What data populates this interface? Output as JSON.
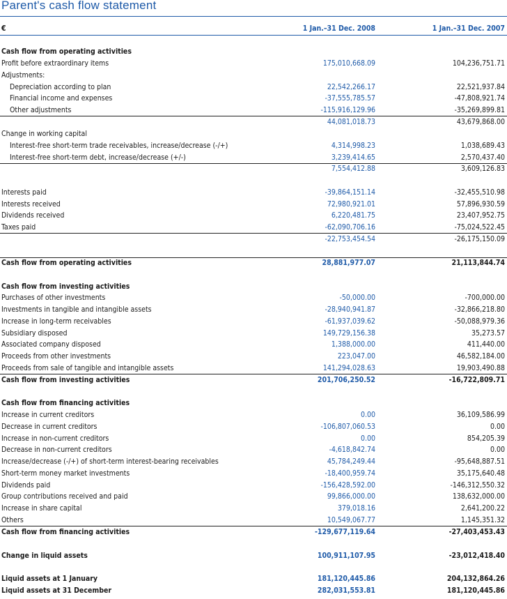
{
  "title": "Parent's cash flow statement",
  "header": {
    "currency": "€",
    "period_2008": "1 Jan.–31 Dec. 2008",
    "period_2007": "1 Jan.–31 Dec. 2007"
  },
  "rows": [
    {
      "label": "Cash flow from operating activities",
      "v1": "",
      "v2": ""
    },
    {
      "label": "Profit before extraordinary items",
      "v1": "175,010,668.09",
      "v2": "104,236,751.71"
    },
    {
      "label": "Adjustments:",
      "v1": "",
      "v2": ""
    },
    {
      "label": "Depreciation according to plan",
      "v1": "22,542,266.17",
      "v2": "22,521,937.84"
    },
    {
      "label": "Financial income and expenses",
      "v1": "-37,555,785.57",
      "v2": "-47,808,921.74"
    },
    {
      "label": "Other adjustments",
      "v1": "-115,916,129.96",
      "v2": "-35,269,899.81"
    },
    {
      "label": "",
      "v1": "44,081,018.73",
      "v2": "43,679,868.00"
    },
    {
      "label": "Change in working capital",
      "v1": "",
      "v2": ""
    },
    {
      "label": "Interest-free short-term trade receivables, increase/decrease (-/+)",
      "v1": "4,314,998.23",
      "v2": "1,038,689.43"
    },
    {
      "label": "Interest-free short-term debt, increase/decrease (+/-)",
      "v1": "3,239,414.65",
      "v2": "2,570,437.40"
    },
    {
      "label": "",
      "v1": "7,554,412.88",
      "v2": "3,609,126.83"
    },
    {
      "label": "Interests paid",
      "v1": "-39,864,151.14",
      "v2": "-32,455,510.98"
    },
    {
      "label": "Interests received",
      "v1": "72,980,921.01",
      "v2": "57,896,930.59"
    },
    {
      "label": "Dividends received",
      "v1": "6,220,481.75",
      "v2": "23,407,952.75"
    },
    {
      "label": "Taxes paid",
      "v1": "-62,090,706.16",
      "v2": "-75,024,522.45"
    },
    {
      "label": "",
      "v1": "-22,753,454.54",
      "v2": "-26,175,150.09"
    },
    {
      "label": "Cash flow from operating activities",
      "v1": "28,881,977.07",
      "v2": "21,113,844.74"
    },
    {
      "label": "Cash flow from investing activities",
      "v1": "",
      "v2": ""
    },
    {
      "label": "Purchases of other investments",
      "v1": "-50,000.00",
      "v2": "-700,000.00"
    },
    {
      "label": "Investments in tangible and intangible assets",
      "v1": "-28,940,941.87",
      "v2": "-32,866,218.80"
    },
    {
      "label": "Increase in long-term receivables",
      "v1": "-61,937,039.62",
      "v2": "-50,088,979.36"
    },
    {
      "label": "Subsidiary disposed",
      "v1": "149,729,156.38",
      "v2": "35,273.57"
    },
    {
      "label": "Associated company disposed",
      "v1": "1,388,000.00",
      "v2": "411,440.00"
    },
    {
      "label": "Proceeds from other investments",
      "v1": "223,047.00",
      "v2": "46,582,184.00"
    },
    {
      "label": "Proceeds from sale of tangible and intangible assets",
      "v1": "141,294,028.63",
      "v2": "19,903,490.88"
    },
    {
      "label": "Cash flow from investing activities",
      "v1": "201,706,250.52",
      "v2": "-16,722,809.71"
    },
    {
      "label": "Cash flow from financing activities",
      "v1": "",
      "v2": ""
    },
    {
      "label": "Increase in current creditors",
      "v1": "0.00",
      "v2": "36,109,586.99"
    },
    {
      "label": "Decrease in current creditors",
      "v1": "-106,807,060.53",
      "v2": "0.00"
    },
    {
      "label": "Increase in non-current creditors",
      "v1": "0.00",
      "v2": "854,205.39"
    },
    {
      "label": "Decrease in non-current creditors",
      "v1": "-4,618,842.74",
      "v2": "0.00"
    },
    {
      "label": "Increase/decrease (-/+) of short-term interest-bearing receivables",
      "v1": "45,784,249.44",
      "v2": "-95,648,887.51"
    },
    {
      "label": "Short-term money market investments",
      "v1": "-18,400,959.74",
      "v2": "35,175,640.48"
    },
    {
      "label": "Dividends paid",
      "v1": "-156,428,592.00",
      "v2": "-146,312,550.32"
    },
    {
      "label": "Group contributions received and paid",
      "v1": "99,866,000.00",
      "v2": "138,632,000.00"
    },
    {
      "label": "Increase in share capital",
      "v1": "379,018.16",
      "v2": "2,641,200.22"
    },
    {
      "label": "Others",
      "v1": "10,549,067.77",
      "v2": "1,145,351.32"
    },
    {
      "label": "Cash flow from financing activities",
      "v1": "-129,677,119.64",
      "v2": "-27,403,453.43"
    },
    {
      "label": "Change in liquid assets",
      "v1": "100,911,107.95",
      "v2": "-23,012,418.40"
    },
    {
      "label": "Liquid assets at 1 January",
      "v1": "181,120,445.86",
      "v2": "204,132,864.26"
    },
    {
      "label": "Liquid assets at 31 December",
      "v1": "282,031,553.81",
      "v2": "181,120,445.86"
    }
  ]
}
